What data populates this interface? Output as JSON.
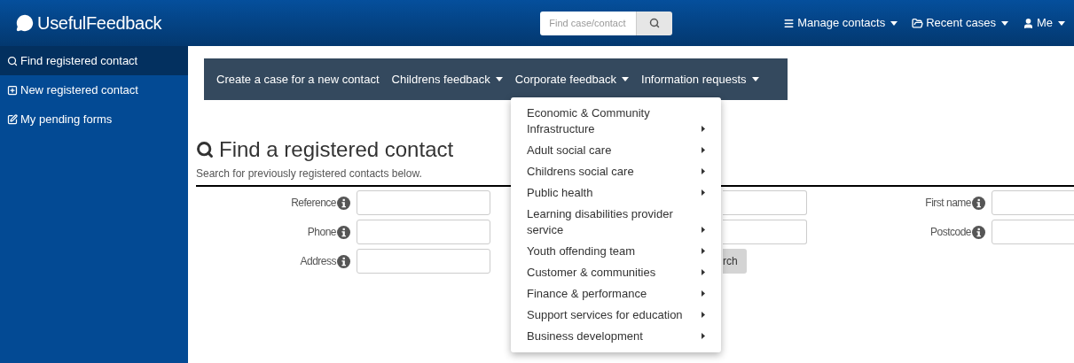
{
  "navbar": {
    "brand": "UsefulFeedback",
    "search": {
      "placeholder": "Find case/contact"
    },
    "menus": [
      {
        "label": "Manage contacts"
      },
      {
        "label": "Recent cases"
      },
      {
        "label": "Me"
      }
    ]
  },
  "sidebar": {
    "items": [
      {
        "label": "Find registered contact",
        "selected": true
      },
      {
        "label": "New registered contact",
        "selected": false
      },
      {
        "label": "My pending forms",
        "selected": false
      }
    ]
  },
  "toolbar": {
    "items": [
      {
        "label": "Create a case for a new contact",
        "dropdown": false
      },
      {
        "label": "Childrens feedback",
        "dropdown": true
      },
      {
        "label": "Corporate feedback",
        "dropdown": true
      },
      {
        "label": "Information requests",
        "dropdown": true
      }
    ]
  },
  "dropdown_menu": {
    "items": [
      {
        "label": "Economic & Community Infrastructure",
        "submenu": true
      },
      {
        "label": "Adult social care",
        "submenu": true
      },
      {
        "label": "Childrens social care",
        "submenu": true
      },
      {
        "label": "Public health",
        "submenu": true
      },
      {
        "label": "Learning disabilities provider service",
        "submenu": true
      },
      {
        "label": "Youth offending team",
        "submenu": true
      },
      {
        "label": "Customer & communities",
        "submenu": true
      },
      {
        "label": "Finance & performance",
        "submenu": true
      },
      {
        "label": "Support services for education",
        "submenu": true
      },
      {
        "label": "Business development",
        "submenu": true
      }
    ]
  },
  "page": {
    "title": "Find a registered contact",
    "subtitle": "Search for previously registered contacts below."
  },
  "form": {
    "rows": [
      {
        "fields": [
          {
            "kind": "labeled",
            "label": "Reference"
          },
          {
            "kind": "partial"
          },
          {
            "kind": "labeled",
            "label": "First name"
          }
        ]
      },
      {
        "fields": [
          {
            "kind": "labeled",
            "label": "Phone"
          },
          {
            "kind": "partial"
          },
          {
            "kind": "labeled",
            "label": "Postcode"
          }
        ]
      },
      {
        "fields": [
          {
            "kind": "labeled",
            "label": "Address"
          },
          {
            "kind": "button",
            "label": "rch"
          }
        ]
      }
    ]
  }
}
